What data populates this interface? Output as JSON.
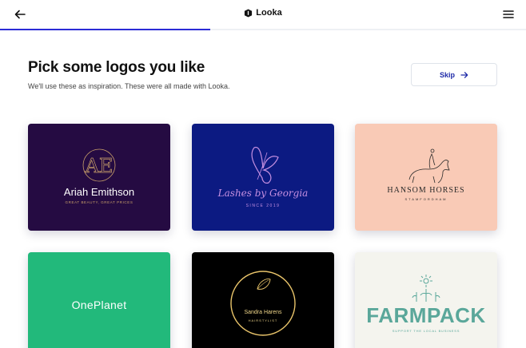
{
  "header": {
    "brand": "Looka",
    "back_icon": "arrow-left-icon",
    "brand_icon": "looka-logo-icon",
    "menu_icon": "hamburger-menu-icon",
    "progress_fraction": 0.4
  },
  "main": {
    "title": "Pick some logos you like",
    "subtitle": "We'll use these as inspiration. These were all made with Looka.",
    "skip_label": "Skip",
    "skip_icon": "arrow-right-icon"
  },
  "logos": [
    {
      "name": "Ariah Emithson",
      "tagline": "GREAT BEAUTY, GREAT PRICES",
      "monogram": "AE",
      "background": "#250b42"
    },
    {
      "name": "Lashes by Georgia",
      "tagline": "SINCE 2019",
      "icon": "butterfly-icon",
      "background": "#0c1a82"
    },
    {
      "name": "HANSOM HORSES",
      "tagline": "STAMFORDHAM",
      "icon": "horse-rider-icon",
      "background": "#f9cab6"
    },
    {
      "name": "OnePlanet",
      "background": "#22b97b"
    },
    {
      "name": "Sandra Harens",
      "tagline": "HAIRSTYLIST",
      "icon": "leaf-circle-icon",
      "background": "#000000"
    },
    {
      "name": "FARMPACK",
      "tagline": "SUPPORT THE LOCAL BUSINESS",
      "icon": "plants-icon",
      "background": "#f4f4ee"
    }
  ],
  "colors": {
    "accent": "#2b2bd6",
    "skip_text": "#1e2aa8"
  }
}
